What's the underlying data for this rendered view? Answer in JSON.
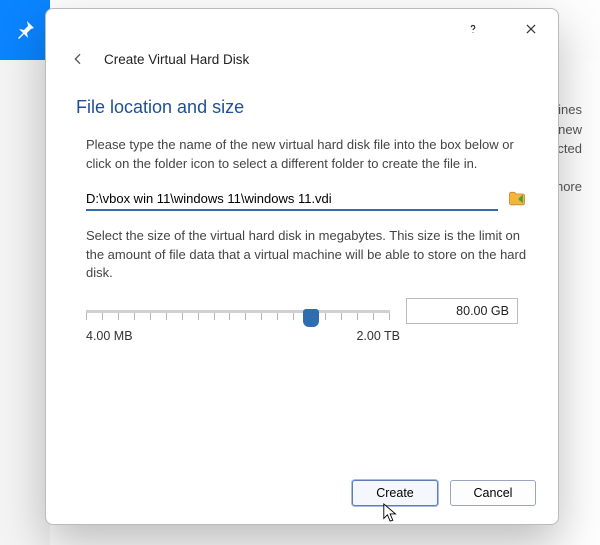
{
  "background": {
    "right_text_fragments": [
      "machines",
      "ate new",
      "y selected",
      "or more"
    ]
  },
  "dialog": {
    "titlebar": {
      "help_tooltip": "Help",
      "close_tooltip": "Close"
    },
    "back_tooltip": "Back",
    "wizard_title": "Create Virtual Hard Disk",
    "step_heading": "File location and size",
    "path_description": "Please type the name of the new virtual hard disk file into the box below or click on the folder icon to select a different folder to create the file in.",
    "path_value": "D:\\vbox win 11\\windows 11\\windows 11.vdi",
    "folder_tooltip": "Choose folder",
    "size_description": "Select the size of the virtual hard disk in megabytes. This size is the limit on the amount of file data that a virtual machine will be able to store on the hard disk.",
    "size_value": "80.00 GB",
    "slider_min_label": "4.00 MB",
    "slider_max_label": "2.00 TB",
    "slider_percent": 74,
    "buttons": {
      "create": "Create",
      "cancel": "Cancel"
    }
  }
}
